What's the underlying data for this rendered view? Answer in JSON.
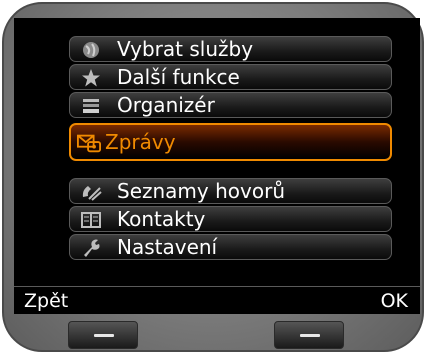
{
  "menu": {
    "items": [
      {
        "label": "Vybrat služby",
        "icon": "globe-icon"
      },
      {
        "label": "Další funkce",
        "icon": "star-icon"
      },
      {
        "label": "Organizér",
        "icon": "organizer-icon"
      },
      {
        "label": "Zprávy",
        "icon": "messages-icon",
        "selected": true
      },
      {
        "label": "Seznamy hovorů",
        "icon": "call-list-icon"
      },
      {
        "label": "Kontakty",
        "icon": "contacts-icon"
      },
      {
        "label": "Nastavení",
        "icon": "wrench-icon"
      }
    ]
  },
  "softkeys": {
    "left": "Zpět",
    "right": "OK"
  },
  "colors": {
    "accent": "#f08a00",
    "screen_bg": "#000000"
  }
}
